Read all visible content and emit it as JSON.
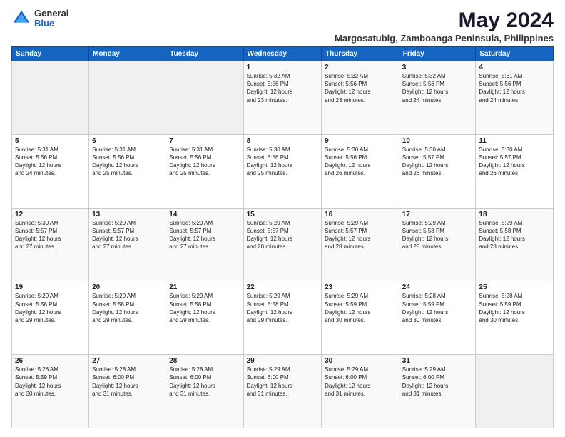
{
  "logo": {
    "general": "General",
    "blue": "Blue"
  },
  "title": "May 2024",
  "subtitle": "Margosatubig, Zamboanga Peninsula, Philippines",
  "weekdays": [
    "Sunday",
    "Monday",
    "Tuesday",
    "Wednesday",
    "Thursday",
    "Friday",
    "Saturday"
  ],
  "weeks": [
    [
      {
        "day": "",
        "info": ""
      },
      {
        "day": "",
        "info": ""
      },
      {
        "day": "",
        "info": ""
      },
      {
        "day": "1",
        "info": "Sunrise: 5:32 AM\nSunset: 5:56 PM\nDaylight: 12 hours\nand 23 minutes."
      },
      {
        "day": "2",
        "info": "Sunrise: 5:32 AM\nSunset: 5:56 PM\nDaylight: 12 hours\nand 23 minutes."
      },
      {
        "day": "3",
        "info": "Sunrise: 5:32 AM\nSunset: 5:56 PM\nDaylight: 12 hours\nand 24 minutes."
      },
      {
        "day": "4",
        "info": "Sunrise: 5:31 AM\nSunset: 5:56 PM\nDaylight: 12 hours\nand 24 minutes."
      }
    ],
    [
      {
        "day": "5",
        "info": "Sunrise: 5:31 AM\nSunset: 5:56 PM\nDaylight: 12 hours\nand 24 minutes."
      },
      {
        "day": "6",
        "info": "Sunrise: 5:31 AM\nSunset: 5:56 PM\nDaylight: 12 hours\nand 25 minutes."
      },
      {
        "day": "7",
        "info": "Sunrise: 5:31 AM\nSunset: 5:56 PM\nDaylight: 12 hours\nand 25 minutes."
      },
      {
        "day": "8",
        "info": "Sunrise: 5:30 AM\nSunset: 5:56 PM\nDaylight: 12 hours\nand 25 minutes."
      },
      {
        "day": "9",
        "info": "Sunrise: 5:30 AM\nSunset: 5:56 PM\nDaylight: 12 hours\nand 26 minutes."
      },
      {
        "day": "10",
        "info": "Sunrise: 5:30 AM\nSunset: 5:57 PM\nDaylight: 12 hours\nand 26 minutes."
      },
      {
        "day": "11",
        "info": "Sunrise: 5:30 AM\nSunset: 5:57 PM\nDaylight: 12 hours\nand 26 minutes."
      }
    ],
    [
      {
        "day": "12",
        "info": "Sunrise: 5:30 AM\nSunset: 5:57 PM\nDaylight: 12 hours\nand 27 minutes."
      },
      {
        "day": "13",
        "info": "Sunrise: 5:29 AM\nSunset: 5:57 PM\nDaylight: 12 hours\nand 27 minutes."
      },
      {
        "day": "14",
        "info": "Sunrise: 5:29 AM\nSunset: 5:57 PM\nDaylight: 12 hours\nand 27 minutes."
      },
      {
        "day": "15",
        "info": "Sunrise: 5:29 AM\nSunset: 5:57 PM\nDaylight: 12 hours\nand 28 minutes."
      },
      {
        "day": "16",
        "info": "Sunrise: 5:29 AM\nSunset: 5:57 PM\nDaylight: 12 hours\nand 28 minutes."
      },
      {
        "day": "17",
        "info": "Sunrise: 5:29 AM\nSunset: 5:58 PM\nDaylight: 12 hours\nand 28 minutes."
      },
      {
        "day": "18",
        "info": "Sunrise: 5:29 AM\nSunset: 5:58 PM\nDaylight: 12 hours\nand 28 minutes."
      }
    ],
    [
      {
        "day": "19",
        "info": "Sunrise: 5:29 AM\nSunset: 5:58 PM\nDaylight: 12 hours\nand 29 minutes."
      },
      {
        "day": "20",
        "info": "Sunrise: 5:29 AM\nSunset: 5:58 PM\nDaylight: 12 hours\nand 29 minutes."
      },
      {
        "day": "21",
        "info": "Sunrise: 5:29 AM\nSunset: 5:58 PM\nDaylight: 12 hours\nand 29 minutes."
      },
      {
        "day": "22",
        "info": "Sunrise: 5:29 AM\nSunset: 5:58 PM\nDaylight: 12 hours\nand 29 minutes."
      },
      {
        "day": "23",
        "info": "Sunrise: 5:29 AM\nSunset: 5:59 PM\nDaylight: 12 hours\nand 30 minutes."
      },
      {
        "day": "24",
        "info": "Sunrise: 5:28 AM\nSunset: 5:59 PM\nDaylight: 12 hours\nand 30 minutes."
      },
      {
        "day": "25",
        "info": "Sunrise: 5:28 AM\nSunset: 5:59 PM\nDaylight: 12 hours\nand 30 minutes."
      }
    ],
    [
      {
        "day": "26",
        "info": "Sunrise: 5:28 AM\nSunset: 5:59 PM\nDaylight: 12 hours\nand 30 minutes."
      },
      {
        "day": "27",
        "info": "Sunrise: 5:28 AM\nSunset: 6:00 PM\nDaylight: 12 hours\nand 31 minutes."
      },
      {
        "day": "28",
        "info": "Sunrise: 5:28 AM\nSunset: 6:00 PM\nDaylight: 12 hours\nand 31 minutes."
      },
      {
        "day": "29",
        "info": "Sunrise: 5:29 AM\nSunset: 6:00 PM\nDaylight: 12 hours\nand 31 minutes."
      },
      {
        "day": "30",
        "info": "Sunrise: 5:29 AM\nSunset: 6:00 PM\nDaylight: 12 hours\nand 31 minutes."
      },
      {
        "day": "31",
        "info": "Sunrise: 5:29 AM\nSunset: 6:00 PM\nDaylight: 12 hours\nand 31 minutes."
      },
      {
        "day": "",
        "info": ""
      }
    ]
  ]
}
